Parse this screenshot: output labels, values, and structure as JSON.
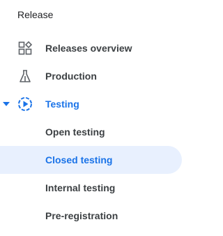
{
  "section": {
    "title": "Release"
  },
  "nav": {
    "releases_overview": {
      "label": "Releases overview",
      "icon": "dashboard-grid-icon"
    },
    "production": {
      "label": "Production",
      "icon": "production-flask-icon"
    },
    "testing": {
      "label": "Testing",
      "icon": "testing-play-circle-icon",
      "expanded": true,
      "children": [
        {
          "label": "Open testing",
          "selected": false
        },
        {
          "label": "Closed testing",
          "selected": true
        },
        {
          "label": "Internal testing",
          "selected": false
        },
        {
          "label": "Pre-registration",
          "selected": false
        }
      ]
    }
  },
  "colors": {
    "accent": "#1a73e8",
    "selected_bg": "#e8f0fe",
    "text": "#3c4043",
    "icon": "#5f6368"
  }
}
